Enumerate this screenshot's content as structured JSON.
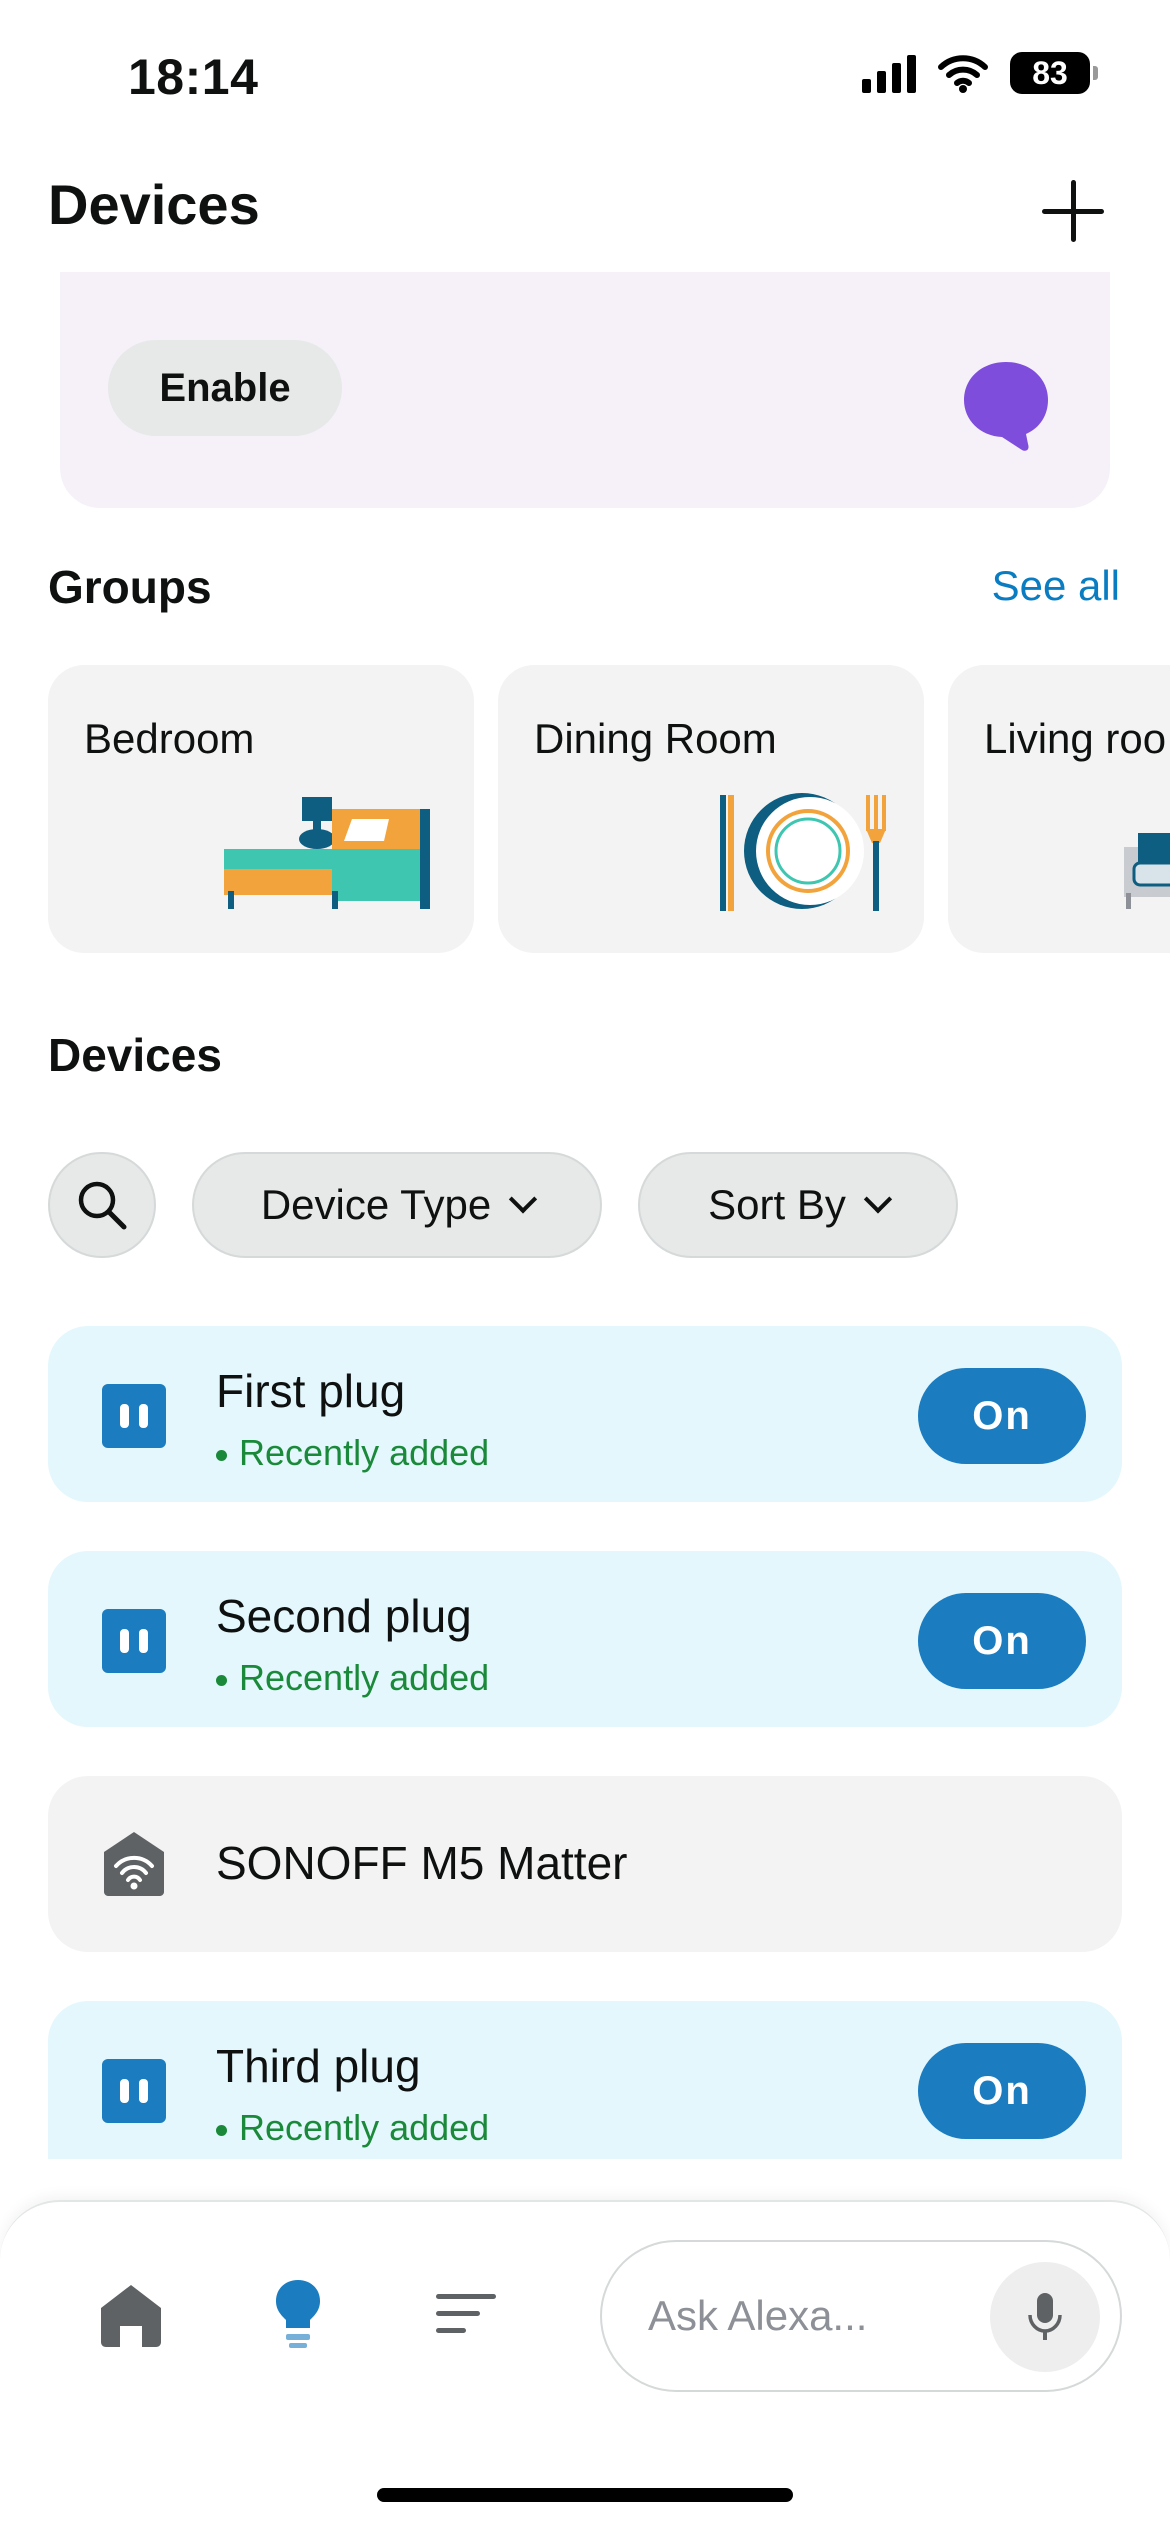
{
  "status_bar": {
    "time": "18:14",
    "battery": "83"
  },
  "header": {
    "title": "Devices",
    "add_icon": "plus-icon"
  },
  "banner": {
    "button_label": "Enable",
    "icon": "alexa-speech-bubble-icon",
    "bubble_color": "#7e4ddb"
  },
  "groups": {
    "title": "Groups",
    "see_all": "See all",
    "items": [
      {
        "label": "Bedroom",
        "icon": "bed-icon"
      },
      {
        "label": "Dining Room",
        "icon": "plate-cutlery-icon"
      },
      {
        "label": "Living roo",
        "icon": "sofa-icon"
      }
    ]
  },
  "devices": {
    "title": "Devices",
    "filters": {
      "search_icon": "search-icon",
      "device_type": "Device Type",
      "sort_by": "Sort By"
    },
    "items": [
      {
        "name": "First plug",
        "status": "Recently added",
        "action": "On",
        "icon": "plug-icon"
      },
      {
        "name": "Second plug",
        "status": "Recently added",
        "action": "On",
        "icon": "plug-icon"
      },
      {
        "name": "SONOFF M5 Matter",
        "icon": "wifi-hub-icon"
      },
      {
        "name": "Third plug",
        "status": "Recently added",
        "action": "On",
        "icon": "plug-icon"
      }
    ]
  },
  "bottom_nav": {
    "items": [
      "home-icon",
      "devices-bulb-icon",
      "more-menu-icon"
    ],
    "ask_placeholder": "Ask Alexa...",
    "mic_icon": "microphone-icon",
    "active_color": "#1b7cc0"
  }
}
